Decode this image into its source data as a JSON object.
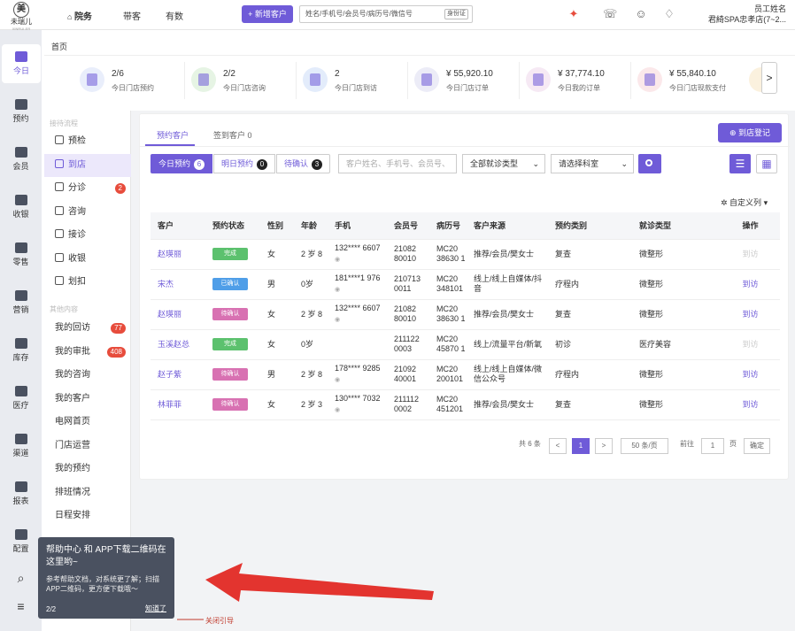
{
  "brand": {
    "mark": "美",
    "name": "未瑞儿",
    "sub": "XINRUI-ER MEDICAL"
  },
  "topnav": [
    {
      "label": "院务"
    },
    {
      "label": "带客"
    },
    {
      "label": "有数"
    }
  ],
  "new_customer_label": "+ 新增客户",
  "search": {
    "placeholder": "姓名/手机号/会员号/病历号/微信号",
    "id_label": "身份证"
  },
  "user": {
    "name": "员工姓名",
    "store": "君綺SPA忠孝店(7~2..."
  },
  "sidebar": [
    {
      "label": "今日"
    },
    {
      "label": "预约"
    },
    {
      "label": "会员"
    },
    {
      "label": "收银"
    },
    {
      "label": "零售"
    },
    {
      "label": "营销"
    },
    {
      "label": "库存"
    },
    {
      "label": "医疗"
    },
    {
      "label": "渠道"
    },
    {
      "label": "报表"
    },
    {
      "label": "配置"
    }
  ],
  "breadcrumb": "首页",
  "stats": [
    {
      "value": "2/6",
      "label": "今日门店预约",
      "color": "#e9eefb"
    },
    {
      "value": "2/2",
      "label": "今日门店咨询",
      "color": "#e6f4e4"
    },
    {
      "value": "2",
      "label": "今日门店到访",
      "color": "#e3ecfb"
    },
    {
      "value": "¥ 55,920.10",
      "label": "今日门店订单",
      "color": "#ececf7"
    },
    {
      "value": "¥ 37,774.10",
      "label": "今日我的订单",
      "color": "#f6e9f4"
    },
    {
      "value": "¥ 55,840.10",
      "label": "今日门店现款支付",
      "color": "#fbe8ea"
    }
  ],
  "flow": {
    "title": "接待流程",
    "items": [
      {
        "label": "预检"
      },
      {
        "label": "到店"
      },
      {
        "label": "分诊",
        "badge": "2"
      },
      {
        "label": "咨询"
      },
      {
        "label": "接诊"
      },
      {
        "label": "收银"
      },
      {
        "label": "划扣"
      }
    ]
  },
  "other": {
    "title": "其他内容",
    "items": [
      {
        "label": "我的回访",
        "badge": "77"
      },
      {
        "label": "我的审批",
        "badge": "408"
      },
      {
        "label": "我的咨询"
      },
      {
        "label": "我的客户"
      },
      {
        "label": "电网首页"
      },
      {
        "label": "门店运营"
      },
      {
        "label": "我的预约"
      },
      {
        "label": "排班情况"
      },
      {
        "label": "日程安排"
      }
    ]
  },
  "tabs": [
    {
      "label": "预约客户"
    },
    {
      "label": "签到客户 0"
    }
  ],
  "register_label": "到店登记",
  "segments": [
    {
      "label": "今日预约",
      "count": "6"
    },
    {
      "label": "明日预约",
      "count": "0"
    },
    {
      "label": "待确认",
      "count": "3"
    }
  ],
  "filter": {
    "placeholder": "客户姓名、手机号、会员号、",
    "type": "全部就诊类型",
    "dept": "请选择科室"
  },
  "custom_cols": "自定义列",
  "columns": [
    "客户",
    "预约状态",
    "性别",
    "年龄",
    "手机",
    "会员号",
    "病历号",
    "客户来源",
    "预约类别",
    "就诊类型",
    "操作"
  ],
  "rows": [
    {
      "name": "赵瑛丽",
      "status": "完成",
      "sc": "#5cc16e",
      "sex": "女",
      "age": "2 岁 8",
      "phone": "132**** 6607",
      "member": "21082 80010",
      "record": "MC20 38630 1",
      "source": "推荐/会员/樊女士",
      "cat": "复查",
      "type": "微整形",
      "op": "到访",
      "opd": true
    },
    {
      "name": "宋杰",
      "status": "已确认",
      "sc": "#4f9ee8",
      "sex": "男",
      "age": "0岁",
      "phone": "181****1 976",
      "member": "210713 0011",
      "record": "MC20 348101",
      "source": "线上/线上自媒体/抖音",
      "cat": "疗程内",
      "type": "微整形",
      "op": "到访",
      "opd": false
    },
    {
      "name": "赵瑛丽",
      "status": "待确认",
      "sc": "#d871b2",
      "sex": "女",
      "age": "2 岁 8",
      "phone": "132**** 6607",
      "member": "21082 80010",
      "record": "MC20 38630 1",
      "source": "推荐/会员/樊女士",
      "cat": "复查",
      "type": "微整形",
      "op": "到访",
      "opd": false
    },
    {
      "name": "玉溪赵总",
      "status": "完成",
      "sc": "#5cc16e",
      "sex": "女",
      "age": "0岁",
      "phone": "",
      "member": "211122 0003",
      "record": "MC20 45870 1",
      "source": "线上/流量平台/新氧",
      "cat": "初诊",
      "type": "医疗美容",
      "op": "到访",
      "opd": true
    },
    {
      "name": "赵子紫",
      "status": "待确认",
      "sc": "#d871b2",
      "sex": "男",
      "age": "2 岁 8",
      "phone": "178**** 9285",
      "member": "21092 40001",
      "record": "MC20 200101",
      "source": "线上/线上自媒体/微信公众号",
      "cat": "疗程内",
      "type": "微整形",
      "op": "到访",
      "opd": false
    },
    {
      "name": "林菲菲",
      "status": "待确认",
      "sc": "#d871b2",
      "sex": "女",
      "age": "2 岁 3",
      "phone": "130**** 7032",
      "member": "211112 0002",
      "record": "MC20 451201",
      "source": "推荐/会员/樊女士",
      "cat": "复查",
      "type": "微整形",
      "op": "到访",
      "opd": false
    }
  ],
  "pager": {
    "total": "共 6 条",
    "prev": "<",
    "current": "1",
    "next": ">",
    "size": "50 条/页",
    "goto": "前往",
    "page_val": "1",
    "page_unit": "页",
    "confirm": "确定"
  },
  "tip": {
    "title": "帮助中心 和 APP下载二维码在这里哟~",
    "desc": "参考帮助文档，对系统更了解；扫描APP二维码，更方便下载哦～",
    "page": "2/2",
    "ok": "知道了"
  },
  "close_guide": "关闭引导",
  "colors": {
    "accent": "#6f5bd8",
    "arrow": "#e3342f"
  }
}
